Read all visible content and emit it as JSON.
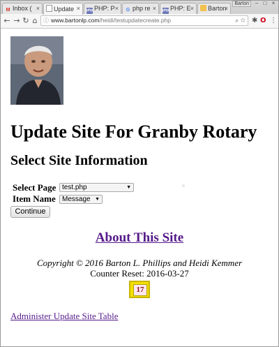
{
  "browser": {
    "tabs": [
      {
        "title": "Inbox (",
        "icon": "gmail-icon",
        "active": false
      },
      {
        "title": "Update",
        "icon": "document-icon",
        "active": true
      },
      {
        "title": "PHP: P",
        "icon": "php-icon",
        "active": false
      },
      {
        "title": "php re",
        "icon": "google-icon",
        "active": false
      },
      {
        "title": "PHP: E",
        "icon": "php-icon",
        "active": false
      },
      {
        "title": "Barton",
        "icon": "document-icon",
        "active": false
      }
    ],
    "user_label": "Barton",
    "url_host": "www.bartonlp.com",
    "url_path": "/heidi/testupdatecreate.php"
  },
  "page": {
    "heading": "Update Site For Granby Rotary",
    "subheading": "Select Site Information",
    "form": {
      "page_label": "Select Page",
      "page_value": "test.php",
      "item_label": "Item Name",
      "item_value": "Message",
      "continue_label": "Continue"
    },
    "about_link": "About This Site",
    "copyright": "Copyright © 2016 Barton L. Phillips and Heidi Kemmer",
    "counter_reset": "Counter Reset: 2016-03-27",
    "counter_value": "17",
    "admin_link": "Administer Update Site Table"
  },
  "colors": {
    "link": "#551a8b",
    "counter_bg": "#f4e000",
    "counter_text": "#8b1010"
  }
}
